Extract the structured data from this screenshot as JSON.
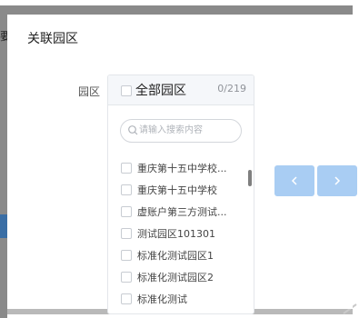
{
  "background": {
    "left_glyph": "要"
  },
  "modal": {
    "title": "关联园区",
    "field_label": "园区"
  },
  "transfer": {
    "header_label": "全部园区",
    "count": "0/219",
    "search_placeholder": "请输入搜索内容",
    "items": [
      {
        "label": "重庆第十五中学校..."
      },
      {
        "label": "重庆第十五中学校"
      },
      {
        "label": "虚账户第三方测试..."
      },
      {
        "label": "测试园区101301"
      },
      {
        "label": "标准化测试园区1"
      },
      {
        "label": "标准化测试园区2"
      },
      {
        "label": "标准化测试"
      }
    ]
  },
  "buttons": {
    "prev_icon": "chevron-left-icon",
    "next_icon": "chevron-right-icon"
  },
  "colors": {
    "button_disabled": "#a9cdf3",
    "panel_header": "#f5f7fa",
    "border": "#e3e6ea"
  }
}
